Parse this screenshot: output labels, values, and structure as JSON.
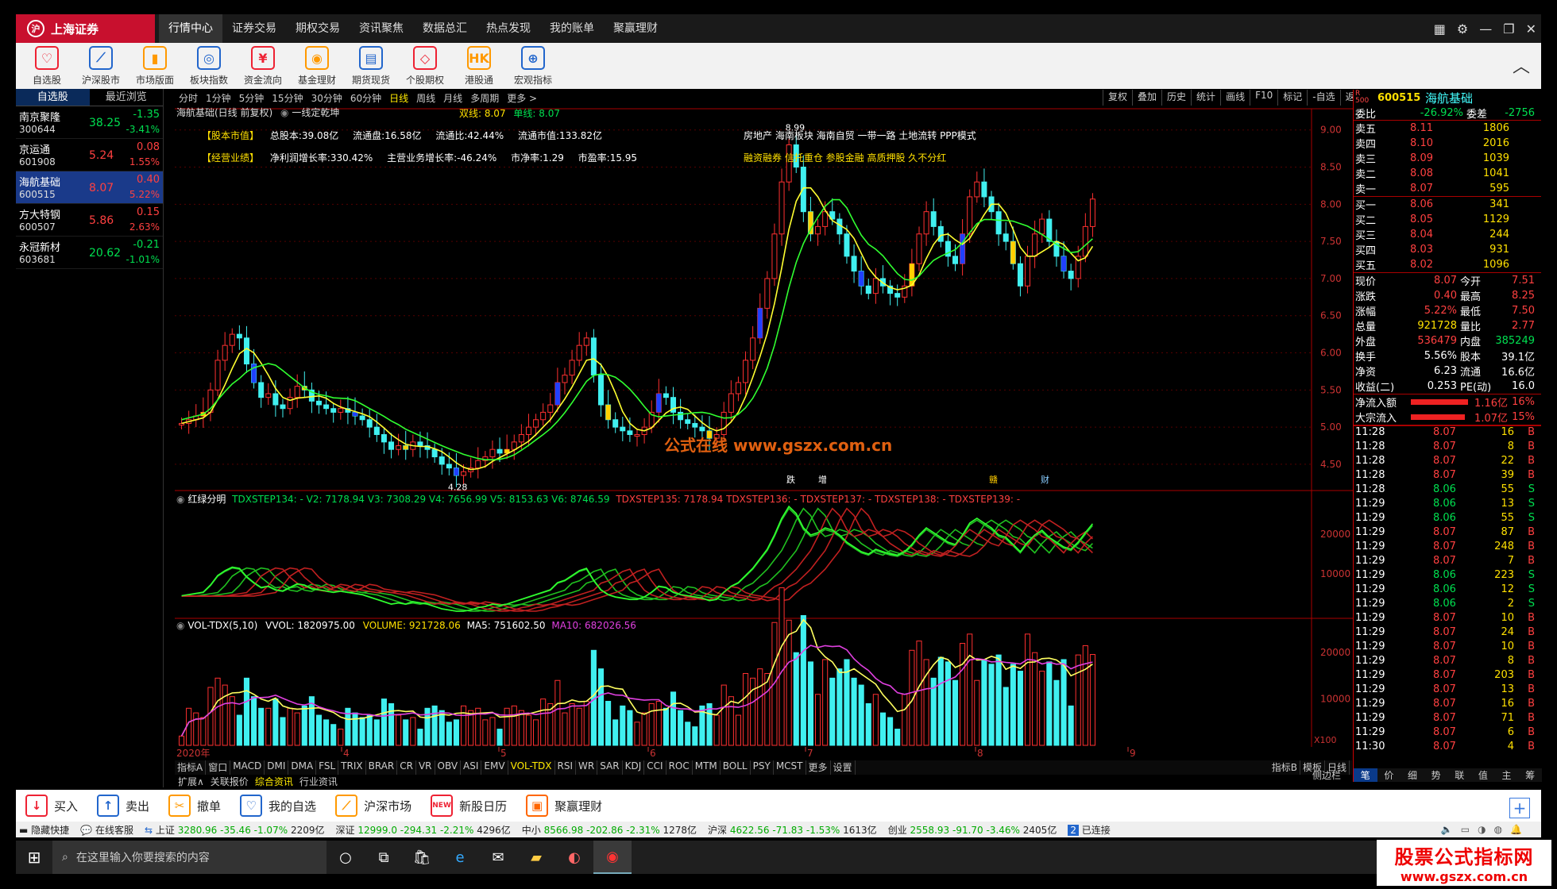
{
  "app": {
    "logo_text": "上海证券",
    "brand_color": "#c8102e"
  },
  "topnav": [
    "行情中心",
    "证券交易",
    "期权交易",
    "资讯聚焦",
    "数据总汇",
    "热点发现",
    "我的账单",
    "聚赢理财"
  ],
  "toolbar": [
    {
      "label": "自选股",
      "color": "#e23"
    },
    {
      "label": "沪深股市",
      "color": "#26c"
    },
    {
      "label": "市场版面",
      "color": "#f90"
    },
    {
      "label": "板块指数",
      "color": "#26c"
    },
    {
      "label": "资金流向",
      "color": "#e23"
    },
    {
      "label": "基金理财",
      "color": "#f90"
    },
    {
      "label": "期货现货",
      "color": "#26c"
    },
    {
      "label": "个股期权",
      "color": "#e23"
    },
    {
      "label": "港股通",
      "color": "#f90",
      "icon_text": "HK"
    },
    {
      "label": "宏观指标",
      "color": "#26c"
    }
  ],
  "left_tabs": [
    "自选股",
    "最近浏览"
  ],
  "watchlist": [
    {
      "name": "南京聚隆",
      "code": "300644",
      "price": "38.25",
      "change": "-1.35",
      "pct": "-3.41%",
      "dir": "down"
    },
    {
      "name": "京运通",
      "code": "601908",
      "price": "5.24",
      "change": "0.08",
      "pct": "1.55%",
      "dir": "up"
    },
    {
      "name": "海航基础",
      "code": "600515",
      "price": "8.07",
      "change": "0.40",
      "pct": "5.22%",
      "dir": "up",
      "selected": true
    },
    {
      "name": "方大特钢",
      "code": "600507",
      "price": "5.86",
      "change": "0.15",
      "pct": "2.63%",
      "dir": "up"
    },
    {
      "name": "永冠新材",
      "code": "603681",
      "price": "20.62",
      "change": "-0.21",
      "pct": "-1.01%",
      "dir": "down"
    }
  ],
  "periods": [
    "分时",
    "1分钟",
    "5分钟",
    "15分钟",
    "30分钟",
    "60分钟",
    "日线",
    "周线",
    "月线",
    "多周期",
    "更多 >"
  ],
  "active_period": "日线",
  "chart_buttons": [
    "复权",
    "叠加",
    "历史",
    "统计",
    "画线",
    "F10",
    "标记",
    "-自选",
    "返回"
  ],
  "main_chart": {
    "title": "海航基础(日线 前复权)",
    "indicator": "一线定乾坤",
    "double_line": "双线: 8.07",
    "single_line": "单线: 8.07",
    "info1_label": "【股本市值】",
    "info1": [
      "总股本:39.08亿",
      "流通盘:16.58亿",
      "流通比:42.44%",
      "流通市值:133.82亿"
    ],
    "info2_label": "【经营业绩】",
    "info2": [
      "净利润增长率:330.42%",
      "主营业务增长率:-46.24%",
      "市净率:1.29",
      "市盈率:15.95"
    ],
    "concepts1": "房地产 海南板块 海南自贸 一带一路 土地流转 PPP模式",
    "concepts2": "融资融券 信托重仓 参股金融 高质押股 久不分红",
    "high_label": "8.99",
    "low_label": "4.28",
    "watermark": "公式在线  www.gszx.com.cn",
    "events": [
      "跌",
      "增",
      "赣",
      "财"
    ],
    "y_ticks": [
      "9.00",
      "8.50",
      "8.00",
      "7.50",
      "7.00",
      "6.50",
      "6.00",
      "5.50",
      "5.00",
      "4.50"
    ]
  },
  "ind_chart": {
    "title": "红绿分明",
    "values": "TDXSTEP134: -  V2: 7178.94  V3: 7308.29  V4: 7656.99  V5: 8153.63  V6: 8746.59",
    "extra": "TDXSTEP135: 7178.94  TDXSTEP136: -  TDXSTEP137: -  TDXSTEP138: -  TDXSTEP139: -",
    "y_ticks": [
      "20000",
      "10000"
    ]
  },
  "vol_chart": {
    "title": "VOL-TDX(5,10)",
    "vvol": "VVOL: 1820975.00",
    "volume": "VOLUME: 921728.06",
    "ma5": "MA5: 751602.50",
    "ma10": "MA10: 682026.56",
    "y_ticks": [
      "20000",
      "10000"
    ],
    "unit": "X100"
  },
  "x_axis": [
    "2020年",
    "4",
    "5",
    "6",
    "7",
    "8",
    "9"
  ],
  "indicator_tabs": [
    "指标A",
    "窗口",
    "MACD",
    "DMI",
    "DMA",
    "FSL",
    "TRIX",
    "BRAR",
    "CR",
    "VR",
    "OBV",
    "ASI",
    "EMV",
    "VOL-TDX",
    "RSI",
    "WR",
    "SAR",
    "KDJ",
    "CCI",
    "ROC",
    "MTM",
    "BOLL",
    "PSY",
    "MCST",
    "更多",
    "设置"
  ],
  "indicator_tabs_right": [
    "指标B",
    "模板",
    "日线"
  ],
  "info_tabs": [
    "扩展∧",
    "关联报价",
    "综合资讯",
    "行业资讯"
  ],
  "quote": {
    "code": "600515",
    "name": "海航基础",
    "weibi_label": "委比",
    "weibi": "-26.92%",
    "weicha_label": "委差",
    "weicha": "-2756",
    "asks": [
      {
        "l": "卖五",
        "p": "8.11",
        "v": "1806"
      },
      {
        "l": "卖四",
        "p": "8.10",
        "v": "2016"
      },
      {
        "l": "卖三",
        "p": "8.09",
        "v": "1039"
      },
      {
        "l": "卖二",
        "p": "8.08",
        "v": "1041"
      },
      {
        "l": "卖一",
        "p": "8.07",
        "v": "595"
      }
    ],
    "bids": [
      {
        "l": "买一",
        "p": "8.06",
        "v": "341"
      },
      {
        "l": "买二",
        "p": "8.05",
        "v": "1129"
      },
      {
        "l": "买三",
        "p": "8.04",
        "v": "244"
      },
      {
        "l": "买四",
        "p": "8.03",
        "v": "931"
      },
      {
        "l": "买五",
        "p": "8.02",
        "v": "1096"
      }
    ],
    "stats": [
      {
        "a": "现价",
        "b": "8.07",
        "bc": "red",
        "c": "今开",
        "d": "7.51",
        "dc": "red"
      },
      {
        "a": "涨跌",
        "b": "0.40",
        "bc": "red",
        "c": "最高",
        "d": "8.25",
        "dc": "red"
      },
      {
        "a": "涨幅",
        "b": "5.22%",
        "bc": "red",
        "c": "最低",
        "d": "7.50",
        "dc": "red"
      },
      {
        "a": "总量",
        "b": "921728",
        "bc": "yellow",
        "c": "量比",
        "d": "2.77",
        "dc": "red"
      },
      {
        "a": "外盘",
        "b": "536479",
        "bc": "red",
        "c": "内盘",
        "d": "385249",
        "dc": "green"
      },
      {
        "a": "换手",
        "b": "5.56%",
        "bc": "white",
        "c": "股本",
        "d": "39.1亿",
        "dc": "white"
      },
      {
        "a": "净资",
        "b": "6.23",
        "bc": "white",
        "c": "流通",
        "d": "16.6亿",
        "dc": "white"
      },
      {
        "a": "收益(二)",
        "b": "0.253",
        "bc": "white",
        "c": "PE(动)",
        "d": "16.0",
        "dc": "white"
      }
    ],
    "flows": [
      {
        "l": "净流入额",
        "v": "1.16亿",
        "p": "16%",
        "frac": 0.8
      },
      {
        "l": "大宗流入",
        "v": "1.07亿",
        "p": "15%",
        "frac": 0.75
      }
    ],
    "ticks": [
      [
        "11:28",
        "8.07",
        "16",
        "B"
      ],
      [
        "11:28",
        "8.07",
        "8",
        "B"
      ],
      [
        "11:28",
        "8.07",
        "22",
        "B"
      ],
      [
        "11:28",
        "8.07",
        "39",
        "B"
      ],
      [
        "11:28",
        "8.06",
        "55",
        "S"
      ],
      [
        "11:29",
        "8.06",
        "13",
        "S"
      ],
      [
        "11:29",
        "8.06",
        "55",
        "S"
      ],
      [
        "11:29",
        "8.07",
        "87",
        "B"
      ],
      [
        "11:29",
        "8.07",
        "248",
        "B"
      ],
      [
        "11:29",
        "8.07",
        "7",
        "B"
      ],
      [
        "11:29",
        "8.06",
        "223",
        "S"
      ],
      [
        "11:29",
        "8.06",
        "12",
        "S"
      ],
      [
        "11:29",
        "8.06",
        "2",
        "S"
      ],
      [
        "11:29",
        "8.07",
        "10",
        "B"
      ],
      [
        "11:29",
        "8.07",
        "24",
        "B"
      ],
      [
        "11:29",
        "8.07",
        "10",
        "B"
      ],
      [
        "11:29",
        "8.07",
        "8",
        "B"
      ],
      [
        "11:29",
        "8.07",
        "203",
        "B"
      ],
      [
        "11:29",
        "8.07",
        "13",
        "B"
      ],
      [
        "11:29",
        "8.07",
        "16",
        "B"
      ],
      [
        "11:29",
        "8.07",
        "71",
        "B"
      ],
      [
        "11:29",
        "8.07",
        "6",
        "B"
      ],
      [
        "11:30",
        "8.07",
        "4",
        "B"
      ]
    ],
    "bottom_tabs": [
      "笔",
      "价",
      "细",
      "势",
      "联",
      "值",
      "主",
      "筹"
    ],
    "side_label": "侧边栏"
  },
  "actions": [
    {
      "label": "买入",
      "color": "#e23"
    },
    {
      "label": "卖出",
      "color": "#26c"
    },
    {
      "label": "撤单",
      "color": "#f90"
    },
    {
      "label": "我的自选",
      "color": "#26c"
    },
    {
      "label": "沪深市场",
      "color": "#f90"
    },
    {
      "label": "新股日历",
      "color": "#e23",
      "icon_text": "NEW"
    },
    {
      "label": "聚赢理财",
      "color": "#f60"
    }
  ],
  "ticker": {
    "hide": "隐藏快捷",
    "service": "在线客服",
    "indexes": [
      {
        "name": "上证",
        "val": "3280.96",
        "chg": "-35.46",
        "pct": "-1.07%",
        "amt": "2209亿"
      },
      {
        "name": "深证",
        "val": "12999.0",
        "chg": "-294.31",
        "pct": "-2.21%",
        "amt": "4296亿"
      },
      {
        "name": "中小",
        "val": "8566.98",
        "chg": "-202.86",
        "pct": "-2.31%",
        "amt": "1278亿"
      },
      {
        "name": "沪深",
        "val": "4622.56",
        "chg": "-71.83",
        "pct": "-1.53%",
        "amt": "1613亿"
      },
      {
        "name": "创业",
        "val": "2558.93",
        "chg": "-91.70",
        "pct": "-3.46%",
        "amt": "2405亿"
      }
    ],
    "status": "已连接",
    "status_num": "2"
  },
  "taskbar": {
    "search_placeholder": "在这里输入你要搜索的内容"
  },
  "site_watermark": {
    "line1": "股票公式指标网",
    "line2": "www.gszx.com.cn"
  },
  "chart_data": {
    "type": "candlestick",
    "title": "海航基础(日线 前复权)",
    "ylim": [
      4.2,
      9.2
    ],
    "closes": [
      5.05,
      5.1,
      5.15,
      5.2,
      5.5,
      5.9,
      6.1,
      6.25,
      6.2,
      5.85,
      5.6,
      5.4,
      5.45,
      5.3,
      5.25,
      5.4,
      5.55,
      5.5,
      5.35,
      5.3,
      5.25,
      5.2,
      5.25,
      5.2,
      5.15,
      5.1,
      5.0,
      4.9,
      4.8,
      4.7,
      4.75,
      4.7,
      4.8,
      4.75,
      4.7,
      4.6,
      4.5,
      4.45,
      4.35,
      4.4,
      4.45,
      4.55,
      4.6,
      4.7,
      4.65,
      4.7,
      4.8,
      4.9,
      5.0,
      5.1,
      5.2,
      5.3,
      5.6,
      5.7,
      5.9,
      6.1,
      6.2,
      5.7,
      5.3,
      5.1,
      5.0,
      4.95,
      4.9,
      4.9,
      5.0,
      5.2,
      5.45,
      5.4,
      5.2,
      5.1,
      5.05,
      5.0,
      4.95,
      4.85,
      4.9,
      5.2,
      5.45,
      5.6,
      5.9,
      6.2,
      6.6,
      7.0,
      7.6,
      8.3,
      8.8,
      8.5,
      7.9,
      7.6,
      7.7,
      7.9,
      7.8,
      7.6,
      7.3,
      7.1,
      6.9,
      6.8,
      7.0,
      6.9,
      6.8,
      6.75,
      6.9,
      7.2,
      7.6,
      7.9,
      7.7,
      7.5,
      7.3,
      7.2,
      7.6,
      8.1,
      8.3,
      8.1,
      7.9,
      7.6,
      7.5,
      7.2,
      6.9,
      7.3,
      7.6,
      7.8,
      7.5,
      7.3,
      7.1,
      7.0,
      7.3,
      7.7,
      8.07
    ],
    "volume_max": 25000
  }
}
